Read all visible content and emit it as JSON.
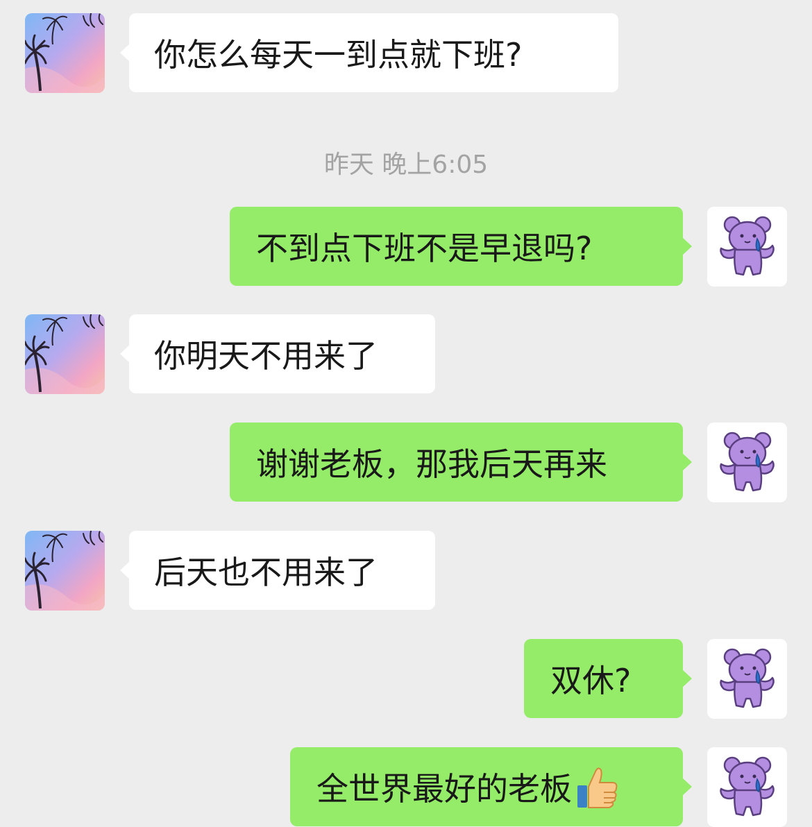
{
  "timestamp": "昨天 晚上6:05",
  "messages": [
    {
      "side": "left",
      "text": "你怎么每天一到点就下班?"
    },
    {
      "side": "right",
      "text": "不到点下班不是早退吗?"
    },
    {
      "side": "left",
      "text": "你明天不用来了"
    },
    {
      "side": "right",
      "text": "谢谢老板，那我后天再来"
    },
    {
      "side": "left",
      "text": "后天也不用来了"
    },
    {
      "side": "right",
      "text": "双休?"
    },
    {
      "side": "right",
      "text": "全世界最好的老板",
      "emoji": "thumbs-up-icon"
    }
  ],
  "avatars": {
    "other": "palm-tree-sunset-icon",
    "self": "purple-bear-icon"
  },
  "colors": {
    "background": "#ededed",
    "left_bubble": "#ffffff",
    "right_bubble": "#95ec69",
    "text": "#191919",
    "timestamp": "#a3a3a3",
    "bear": "#b48ee0"
  }
}
